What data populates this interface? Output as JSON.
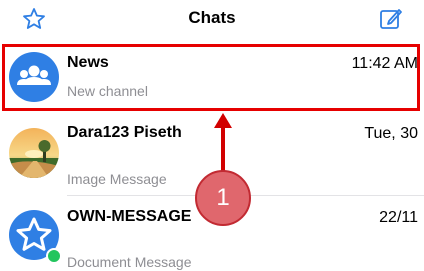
{
  "header": {
    "title": "Chats",
    "left_icon": "star-icon",
    "right_icon": "compose-icon"
  },
  "chats": [
    {
      "name": "News",
      "time": "11:42 AM",
      "subtitle": "New channel",
      "avatar": "group-icon"
    },
    {
      "name": "Dara123 Piseth",
      "time": "Tue, 30",
      "subtitle": "Image Message",
      "avatar": "landscape-photo"
    },
    {
      "name": "OWN-MESSAGE",
      "time": "22/11",
      "subtitle": "Document Message",
      "avatar": "star-icon",
      "online": true
    }
  ],
  "annotation": {
    "callout_number": "1"
  },
  "colors": {
    "accent": "#2f7fe4",
    "highlight": "#e60000",
    "callout": "#e0676d",
    "subtext": "#8e8e93",
    "online": "#22c55e"
  }
}
